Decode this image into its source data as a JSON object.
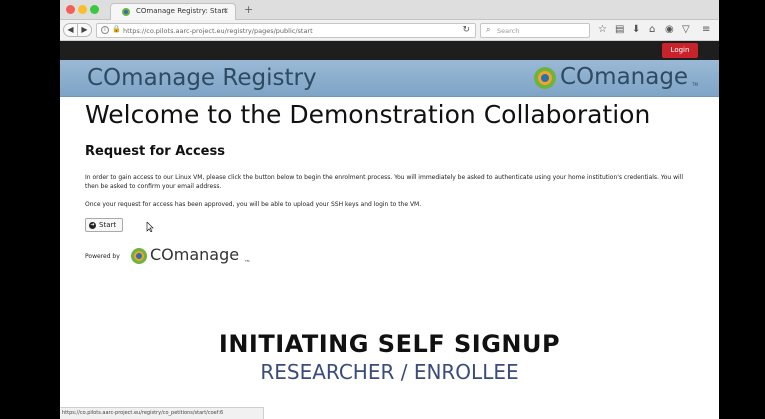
{
  "browser": {
    "tab_title": "COmanage Registry: Start",
    "tab_close": "×",
    "new_tab": "+",
    "url": "https://co.pilots.aarc-project.eu/registry/pages/public/start",
    "search_placeholder": "Search",
    "status_url": "https://co.pilots.aarc-project.eu/registry/co_petitions/start/coef:6"
  },
  "header": {
    "login_label": "Login",
    "banner_title": "COmanage Registry",
    "logo_text": "COmanage",
    "logo_tm": "TM"
  },
  "main": {
    "welcome": "Welcome to the Demonstration Collaboration",
    "heading": "Request for Access",
    "paragraph1": "In order to gain access to our Linux VM, please click the button below to begin the enrolment process. You will immediately be asked to authenticate using your home institution's credentials. You will then be asked to confirm your email address.",
    "paragraph2": "Once your request for access has been approved, you will be able to upload your SSH keys and login to the VM.",
    "start_label": "Start",
    "powered_by": "Powered by",
    "powered_logo_text": "COmanage",
    "powered_logo_tm": "TM"
  },
  "overlay": {
    "title": "INITIATING SELF SIGNUP",
    "subtitle": "RESEARCHER / ENROLLEE"
  },
  "colors": {
    "banner": "#8eb1d1",
    "login_button": "#c8232b",
    "topbar": "#1e1e1e",
    "subtitle": "#3a4b7e"
  }
}
